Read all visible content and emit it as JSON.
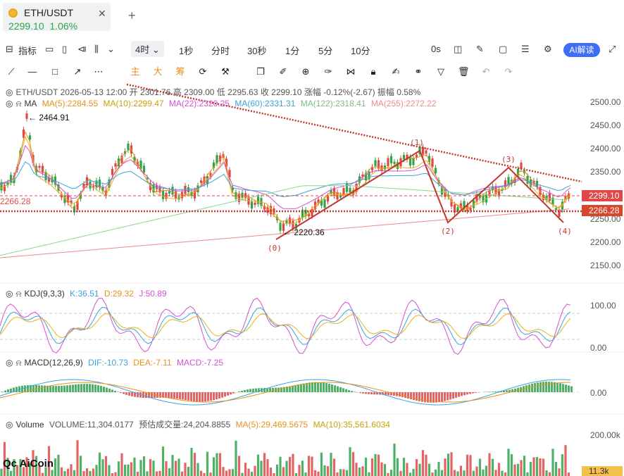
{
  "tab": {
    "symbol": "ETH/USDT",
    "price": "2299.10",
    "change": "1.06%",
    "close": "✕",
    "add": "+"
  },
  "toolbar1": {
    "indicators": "指标",
    "interval_selected": "4时",
    "intervals": [
      "1秒",
      "分时",
      "30秒",
      "1分",
      "5分",
      "10分"
    ],
    "countdown": "0s",
    "ai_label": "AI解读"
  },
  "toolbar2": {
    "main_label": "主",
    "big_label": "大",
    "chip_label": "筹"
  },
  "main_legend": {
    "info": "ETH/USDT  2026-05-13 12:00  开 2301.76  高 2309.00  低 2295.63  收 2299.10  涨幅 -0.12%(-2.67)  振幅 0.58%",
    "ma_label": "MA",
    "ma5": "MA(5):2284.55",
    "ma10": "MA(10):2299.47",
    "ma22": "MA(22):2320.25",
    "ma60": "MA(60):2331.31",
    "ma122": "MA(122):2318.41",
    "ma255": "MA(255):2272.22"
  },
  "annotations": {
    "high": "← 2464.91",
    "low": "← 2220.36",
    "left_price": "2266.28",
    "waves": [
      "(0)",
      "(1)",
      "(2)",
      "(3)",
      "(4)"
    ]
  },
  "price_axis": [
    "2500.00",
    "2450.00",
    "2400.00",
    "2350.00",
    "2300.00",
    "2250.00",
    "2200.00",
    "2150.00"
  ],
  "price_tags": {
    "current": "2299.10",
    "line": "2266.28"
  },
  "kdj": {
    "label": "KDJ(9,3,3)",
    "k": "K:36.51",
    "d": "D:29.32",
    "j": "J:50.89",
    "axis": [
      "100.00",
      "0.00"
    ]
  },
  "macd": {
    "label": "MACD(12,26,9)",
    "dif": "DIF:-10.73",
    "dea": "DEA:-7.11",
    "macd": "MACD:-7.25",
    "axis": [
      "0.00"
    ]
  },
  "volume": {
    "label": "Volume",
    "vol": "VOLUME:11,304.0177",
    "est": "预估成交量:24,204.8855",
    "ma5": "MA(5):29,469.5675",
    "ma10": "MA(10):35,561.6034",
    "axis": [
      "200.00k"
    ],
    "tag": "11.3k"
  },
  "logo": "AiCoin",
  "colors": {
    "up": "#2ea54b",
    "down": "#e04848",
    "ma5": "#e8901a",
    "ma10": "#e8b21a",
    "ma22": "#d64fd1",
    "ma60": "#3aa3d9",
    "ma122": "#8dd38a",
    "ma255": "#f08a8a",
    "trend": "#c0392b"
  }
}
